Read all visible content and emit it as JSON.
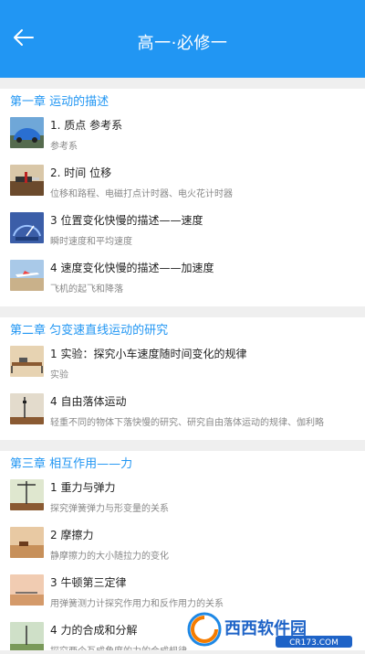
{
  "header": {
    "title": "高一·必修一",
    "back_icon": "arrow-left-icon"
  },
  "chapters": [
    {
      "title": "第一章 运动的描述",
      "lessons": [
        {
          "title": "1. 质点 参考系",
          "subtitle": "参考系"
        },
        {
          "title": "2. 时间 位移",
          "subtitle": "位移和路程、电磁打点计时器、电火花计时器"
        },
        {
          "title": "3 位置变化快慢的描述——速度",
          "subtitle": "瞬时速度和平均速度"
        },
        {
          "title": "4 速度变化快慢的描述——加速度",
          "subtitle": "飞机的起飞和降落"
        }
      ]
    },
    {
      "title": "第二章 匀变速直线运动的研究",
      "lessons": [
        {
          "title": "1 实验：探究小车速度随时间变化的规律",
          "subtitle": "实验"
        },
        {
          "title": "4 自由落体运动",
          "subtitle": "轻重不同的物体下落快慢的研究、研究自由落体运动的规律、伽利略"
        }
      ]
    },
    {
      "title": "第三章 相互作用——力",
      "lessons": [
        {
          "title": "1 重力与弹力",
          "subtitle": "探究弹簧弹力与形变量的关系"
        },
        {
          "title": "2 摩擦力",
          "subtitle": "静摩擦力的大小随拉力的变化"
        },
        {
          "title": "3 牛顿第三定律",
          "subtitle": "用弹簧测力计探究作用力和反作用力的关系"
        },
        {
          "title": "4 力的合成和分解",
          "subtitle": "探究两个互成角度的力的合成规律"
        }
      ]
    }
  ],
  "watermark": {
    "brand": "西西软件园",
    "domain": "CR173.COM"
  },
  "colors": {
    "accent": "#2196f3",
    "background": "#efefef"
  }
}
